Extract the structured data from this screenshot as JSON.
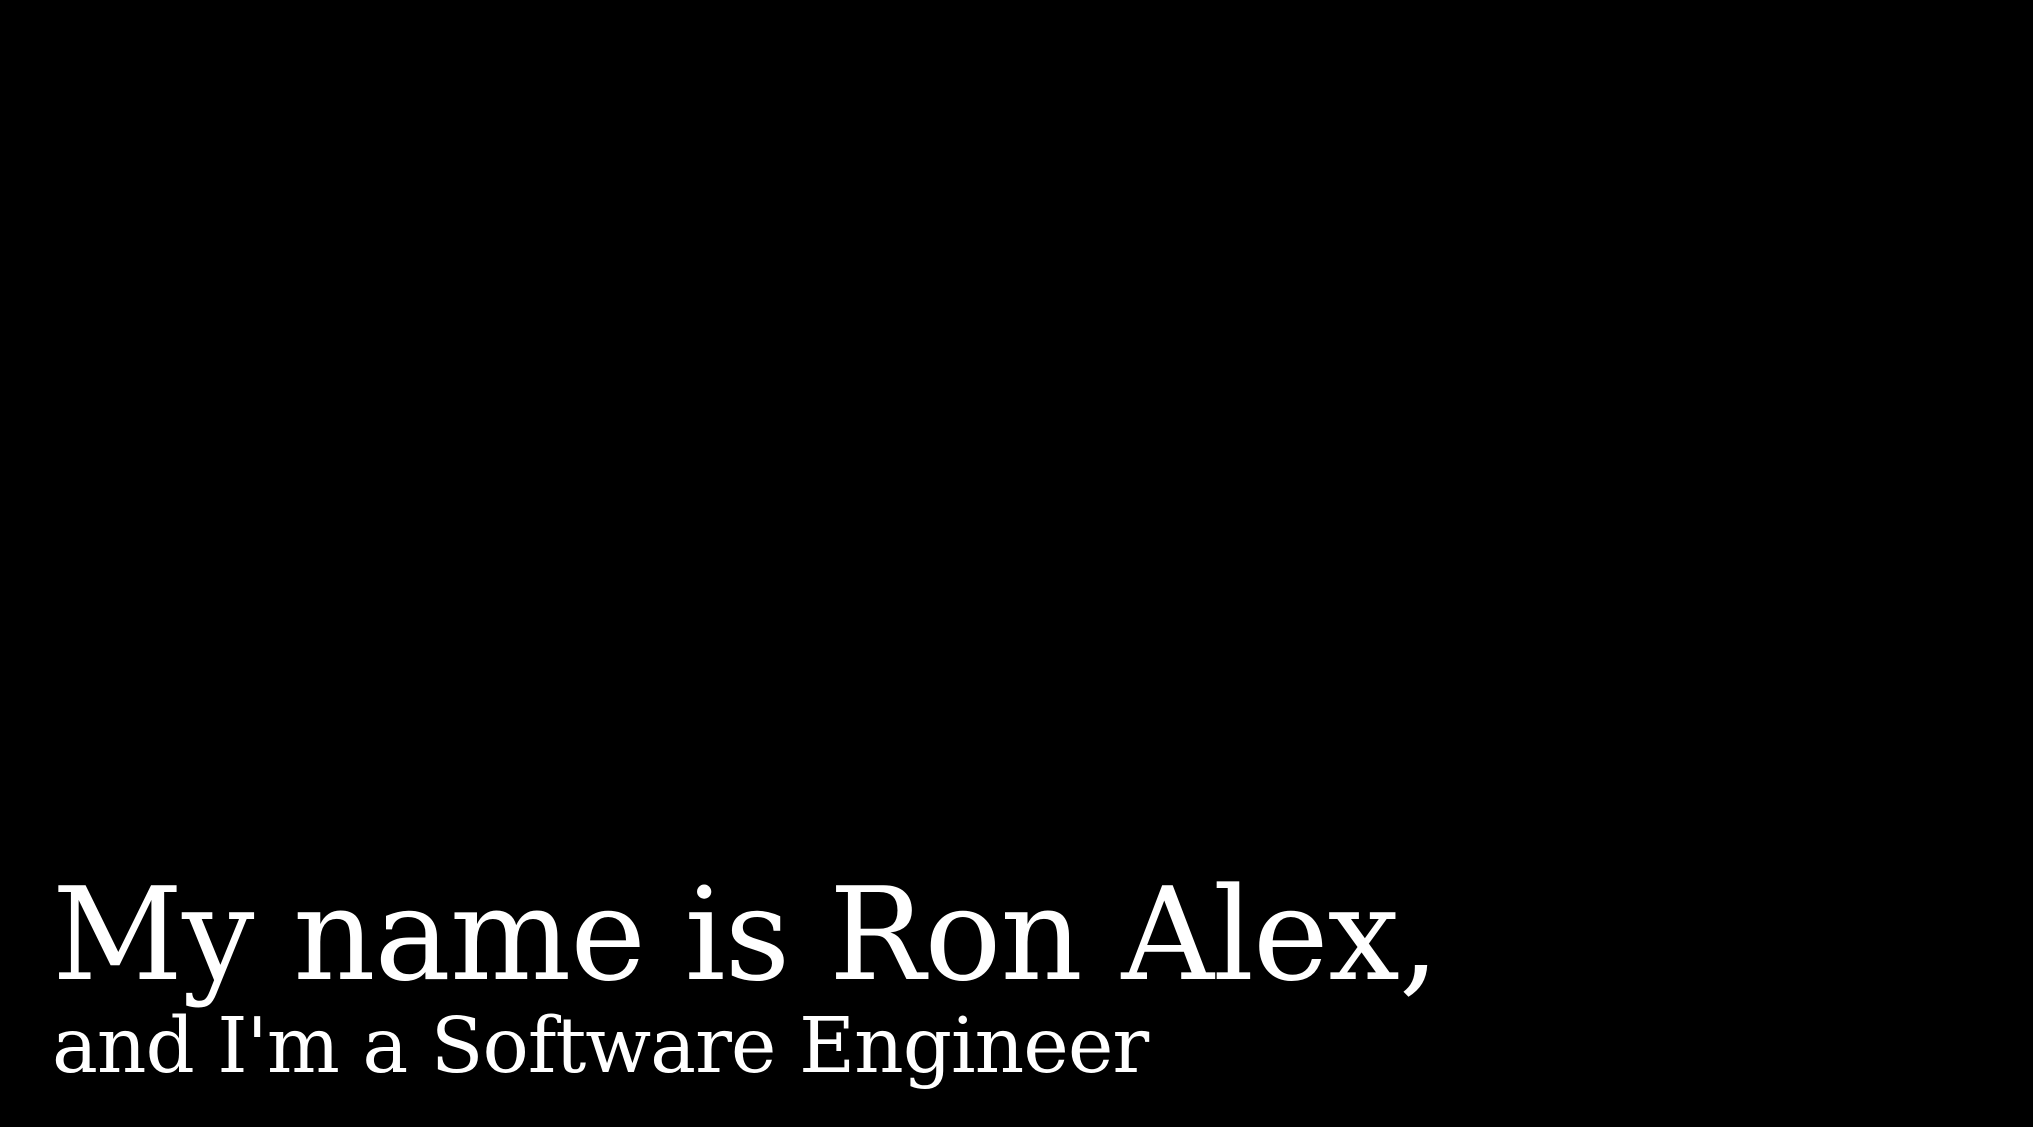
{
  "hero": {
    "name_line": "My name is Ron Alex,",
    "role_line": "and I'm a Software Engineer"
  },
  "colors": {
    "background": "#000000",
    "text": "#ffffff"
  }
}
